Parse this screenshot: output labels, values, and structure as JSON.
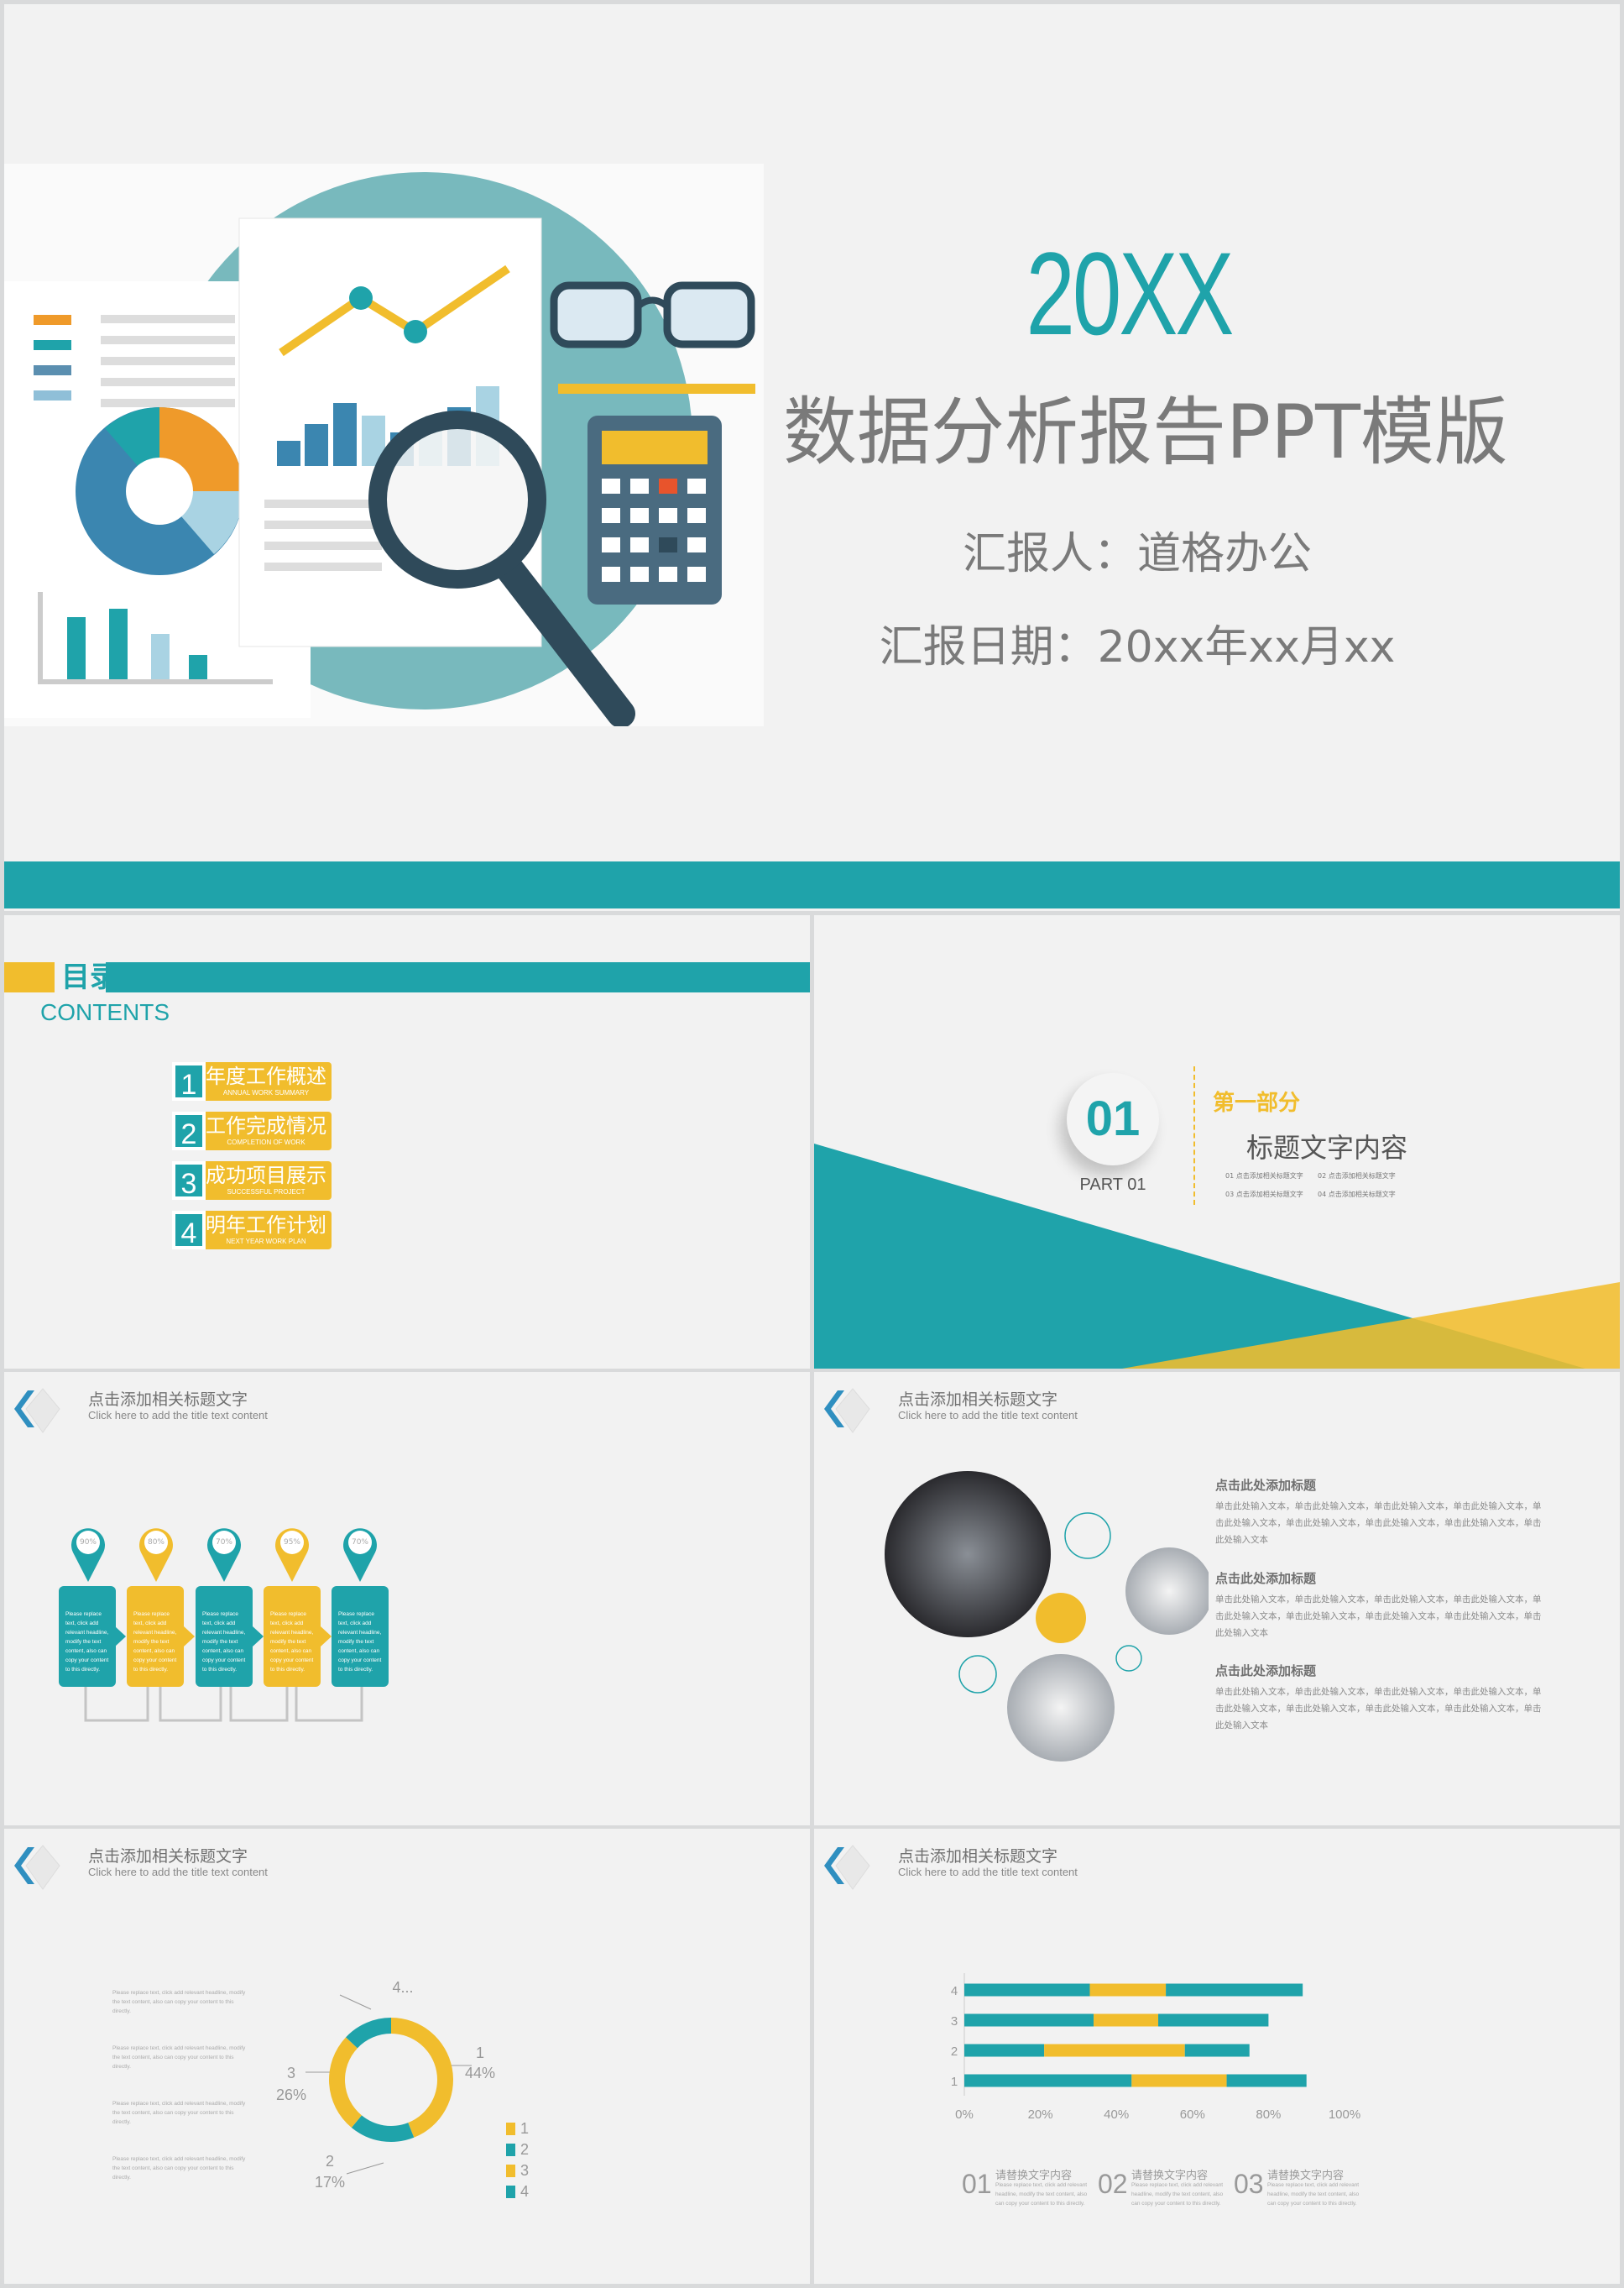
{
  "colors": {
    "teal": "#1fa3aa",
    "yellow": "#f1bd2d",
    "gray_text": "#777777",
    "background": "#f2f2f2"
  },
  "title_slide": {
    "year": "20XX",
    "title": "数据分析报告PPT模版",
    "reporter": "汇报人：道格办公",
    "date": "汇报日期：20xx年xx月xx",
    "illustration_icons": [
      "document-chart-icon",
      "line-chart-icon",
      "bar-chart-icon",
      "pie-chart-icon",
      "glasses-icon",
      "pencil-icon",
      "calculator-icon",
      "magnifier-icon"
    ]
  },
  "contents_slide": {
    "title": "目录",
    "subtitle": "CONTENTS",
    "items": [
      {
        "num": "1",
        "cn": "年度工作概述",
        "en": "ANNUAL WORK SUMMARY"
      },
      {
        "num": "2",
        "cn": "工作完成情况",
        "en": "COMPLETION OF WORK"
      },
      {
        "num": "3",
        "cn": "成功项目展示",
        "en": "SUCCESSFUL PROJECT"
      },
      {
        "num": "4",
        "cn": "明年工作计划",
        "en": "NEXT YEAR WORK PLAN"
      }
    ]
  },
  "part_slide": {
    "number": "01",
    "part_label": "PART 01",
    "section": "第一部分",
    "heading": "标题文字内容",
    "items": [
      "01 点击添加相关标题文字",
      "02 点击添加相关标题文字",
      "03 点击添加相关标题文字",
      "04 点击添加相关标题文字"
    ]
  },
  "slide_header": {
    "title": "点击添加相关标题文字",
    "subtitle": "Click here to add the title text content"
  },
  "process_slide": {
    "steps": [
      {
        "percent": "90%",
        "color": "teal",
        "text": "Please replace text, click add relevant headline, modify the text content, also can copy your content to this directly."
      },
      {
        "percent": "80%",
        "color": "yellow",
        "text": "Please replace text, click add relevant headline, modify the text content, also can copy your content to this directly."
      },
      {
        "percent": "70%",
        "color": "teal",
        "text": "Please replace text, click add relevant headline, modify the text content, also can copy your content to this directly."
      },
      {
        "percent": "95%",
        "color": "yellow",
        "text": "Please replace text, click add relevant headline, modify the text content, also can copy your content to this directly."
      },
      {
        "percent": "70%",
        "color": "teal",
        "text": "Please replace text, click add relevant headline, modify the text content, also can copy your content to this directly."
      }
    ]
  },
  "image_slide": {
    "blocks": [
      {
        "heading": "点击此处添加标题",
        "body": "单击此处输入文本，单击此处输入文本，单击此处输入文本，单击此处输入文本，单击此处输入文本，单击此处输入文本，单击此处输入文本，单击此处输入文本，单击此处输入文本"
      },
      {
        "heading": "点击此处添加标题",
        "body": "单击此处输入文本，单击此处输入文本，单击此处输入文本，单击此处输入文本，单击此处输入文本，单击此处输入文本，单击此处输入文本，单击此处输入文本，单击此处输入文本"
      },
      {
        "heading": "点击此处添加标题",
        "body": "单击此处输入文本，单击此处输入文本，单击此处输入文本，单击此处输入文本，单击此处输入文本，单击此处输入文本，单击此处输入文本，单击此处输入文本，单击此处输入文本"
      }
    ]
  },
  "donut_slide": {
    "texts": [
      "Please replace text, click add relevant headline, modify the text content, also can copy your content to this directly.",
      "Please replace text, click add relevant headline, modify the text content, also can copy your content to this directly.",
      "Please replace text, click add relevant headline, modify the text content, also can copy your content to this directly.",
      "Please replace text, click add relevant headline, modify the text content, also can copy your content to this directly."
    ],
    "labels": {
      "s1_name": "1",
      "s1_pct": "44%",
      "s2_name": "2",
      "s2_pct": "17%",
      "s3_name": "3",
      "s3_pct": "26%",
      "s4_name": "4..."
    }
  },
  "bar_slide": {
    "blocks": [
      {
        "num": "01",
        "title": "请替换文字内容",
        "text": "Please replace text, click add relevant headline, modify the text content, also can copy your content to this directly."
      },
      {
        "num": "02",
        "title": "请替换文字内容",
        "text": "Please replace text, click add relevant headline, modify the text content, also can copy your content to this directly."
      },
      {
        "num": "03",
        "title": "请替换文字内容",
        "text": "Please replace text, click add relevant headline, modify the text content, also can copy your content to this directly."
      }
    ]
  },
  "chart_data": [
    {
      "type": "pie",
      "variant": "donut",
      "categories": [
        "1",
        "2",
        "3",
        "4"
      ],
      "values": [
        44,
        17,
        26,
        13
      ],
      "colors": [
        "#f1bd2d",
        "#1fa3aa",
        "#f1bd2d",
        "#1fa3aa"
      ],
      "legend": [
        "1",
        "2",
        "3",
        "4"
      ],
      "legend_position": "bottom-right"
    },
    {
      "type": "bar",
      "orientation": "horizontal",
      "stacked": true,
      "categories": [
        "1",
        "2",
        "3",
        "4"
      ],
      "series": [
        {
          "values": [
            44,
            21,
            34,
            33
          ],
          "color": "#1fa3aa"
        },
        {
          "values": [
            25,
            37,
            17,
            20
          ],
          "color": "#f1bd2d"
        },
        {
          "values": [
            21,
            17,
            29,
            36
          ],
          "color": "#1fa3aa"
        }
      ],
      "xlim": [
        0,
        1
      ],
      "xticks": [
        "0%",
        "20%",
        "40%",
        "60%",
        "80%",
        "100%"
      ],
      "grid": false
    }
  ]
}
